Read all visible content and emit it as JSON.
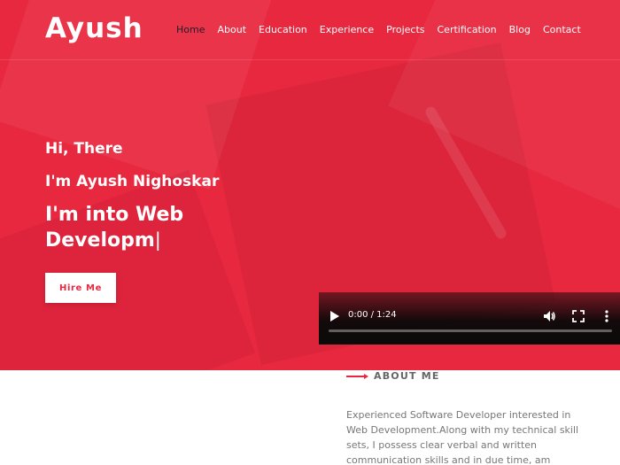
{
  "brand": {
    "logo": "Ayush"
  },
  "nav": {
    "items": [
      {
        "label": "Home",
        "active": true
      },
      {
        "label": "About"
      },
      {
        "label": "Education"
      },
      {
        "label": "Experience"
      },
      {
        "label": "Projects"
      },
      {
        "label": "Certification"
      },
      {
        "label": "Blog"
      },
      {
        "label": "Contact"
      }
    ]
  },
  "hero": {
    "greeting": "Hi, There",
    "name": "I'm Ayush Nighoskar",
    "typed_text": "I'm into Web Developm",
    "cursor": "|",
    "hire_button": "Hire Me",
    "accent_color": "#e8283f"
  },
  "video": {
    "time": "0:00 / 1:24",
    "progress": 0,
    "icons": [
      "play-icon",
      "volume-icon",
      "fullscreen-icon",
      "more-options-icon"
    ]
  },
  "about": {
    "heading": "ABOUT ME",
    "text": "Experienced Software Developer interested in Web Development.Along with my technical skill sets, I possess clear verbal and written communication skills and in due time, am"
  }
}
